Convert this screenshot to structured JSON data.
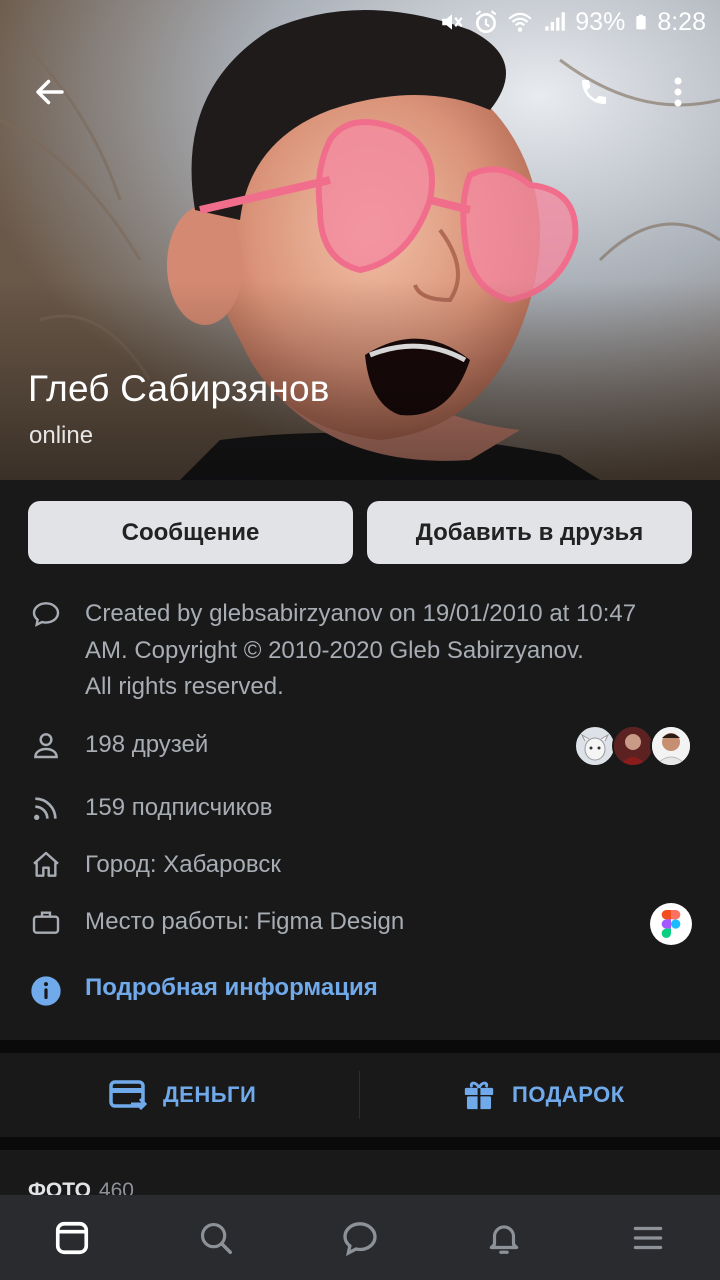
{
  "statusbar": {
    "battery": "93%",
    "time": "8:28",
    "icons": [
      "mute-icon",
      "alarm-icon",
      "wifi-icon",
      "signal-icon",
      "battery-icon"
    ]
  },
  "profile": {
    "name": "Глеб Сабирзянов",
    "status": "online"
  },
  "actions": {
    "message": "Сообщение",
    "add_friend": "Добавить в друзья"
  },
  "info": {
    "about_lines": [
      "Created by glebsabirzyanov on 19/01/2010 at 10:47",
      "AM. Copyright  ©  2010-2020 Gleb Sabirzyanov.",
      "All rights reserved."
    ],
    "friends": "198 друзей",
    "followers": "159 подписчиков",
    "city": "Город: Хабаровск",
    "work": "Место работы: Figma Design",
    "more": "Подробная информация"
  },
  "action_bar": {
    "money": "ДЕНЬГИ",
    "gift": "ПОДАРОК"
  },
  "photos": {
    "label": "ФОТО",
    "count": "460"
  },
  "colors": {
    "background": "#19191a",
    "accent": "#71aaeb",
    "button": "#e1e3e6",
    "nav": "#2a2b2e"
  }
}
